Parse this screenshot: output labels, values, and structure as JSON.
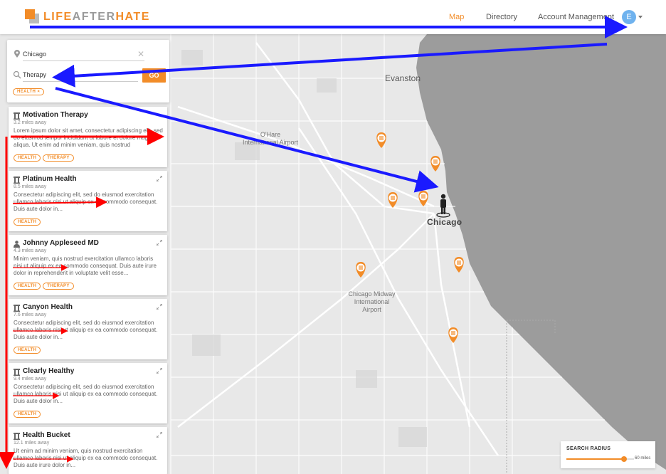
{
  "brand": {
    "logo_text_a": "LIFE",
    "logo_text_b": "AFTER",
    "logo_text_c": "HATE",
    "accent": "#f28c28"
  },
  "nav": {
    "items": [
      "Map",
      "Directory",
      "Account Management"
    ],
    "active": "Map",
    "avatar_initial": "E"
  },
  "search": {
    "location_value": "Chicago",
    "query_value": "Therapy",
    "go_label": "GO",
    "filter_chip": "HEALTH ×"
  },
  "results": [
    {
      "title": "Motivation Therapy",
      "distance": "3.2 miles away",
      "description": "Lorem ipsum dolor sit amet, consectetur adipiscing elit, sed do eiusmod tempor incididunt ut labore et dolore magna aliqua. Ut enim ad minim veniam, quis nostrud",
      "tags": [
        "HEALTH",
        "THERAPY"
      ],
      "icon": "building-icon"
    },
    {
      "title": "Platinum Health",
      "distance": "8.5 miles away",
      "description": "Consectetur adipiscing elit, sed do eiusmod exercitation ullamco laboris nisi ut aliquip ex ea commodo consequat. Duis aute dolor in...",
      "tags": [
        "HEALTH"
      ],
      "icon": "building-icon"
    },
    {
      "title": "Johnny Appleseed MD",
      "distance": "4.3 miles away",
      "description": "Minim veniam, quis nostrud exercitation ullamco laboris nisi ut aliquip ex ea commodo consequat. Duis aute irure dolor in reprehenderit in voluptate velit esse...",
      "tags": [
        "HEALTH",
        "THERAPY"
      ],
      "icon": "person-icon"
    },
    {
      "title": "Canyon Health",
      "distance": "7.6 miles away",
      "description": "Consectetur adipiscing elit, sed do eiusmod exercitation ullamco laboris nisi ut aliquip ex ea commodo consequat. Duis aute dolor in...",
      "tags": [
        "HEALTH"
      ],
      "icon": "building-icon"
    },
    {
      "title": "Clearly Healthy",
      "distance": "9.4 miles away",
      "description": "Consectetur adipiscing elit, sed do eiusmod exercitation ullamco laboris nisi ut aliquip ex ea commodo consequat. Duis aute dolor in...",
      "tags": [
        "HEALTH"
      ],
      "icon": "building-icon"
    },
    {
      "title": "Health Bucket",
      "distance": "12.1 miles away",
      "description": "Ut enim ad minim veniam, quis nostrud exercitation ullamco laboris nisi ut aliquip ex ea commodo consequat. Duis aute irure dolor in...",
      "tags": [],
      "icon": "building-icon"
    }
  ],
  "map": {
    "labels": {
      "evanston": "Evanston",
      "ohare": "O'Hare International Airport",
      "midway": "Chicago Midway International Airport",
      "city": "Chicago"
    }
  },
  "radius": {
    "label": "SEARCH RADIUS",
    "value_text": "60 miles",
    "level": 0.85
  },
  "colors": {
    "arrow_blue": "#1a1aff",
    "arrow_red": "#ff0000",
    "water": "#9a9a9a",
    "pin": "#f28c28"
  }
}
